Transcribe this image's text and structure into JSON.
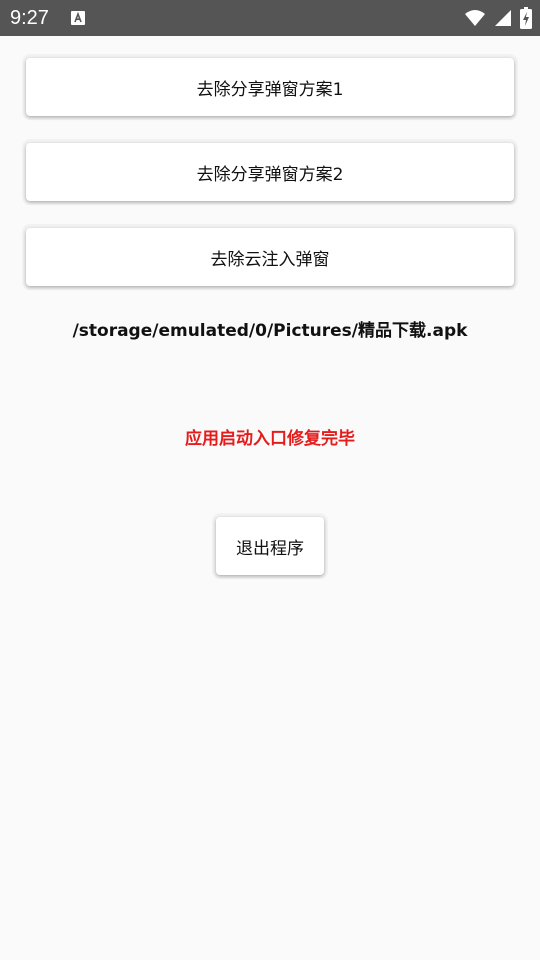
{
  "status_bar": {
    "time": "9:27",
    "notification_icon": "font-a-icon",
    "icons": [
      "wifi-icon",
      "signal-icon",
      "battery-charging-icon"
    ]
  },
  "buttons": {
    "remove_share_popup_1": "去除分享弹窗方案1",
    "remove_share_popup_2": "去除分享弹窗方案2",
    "remove_cloud_injection_popup": "去除云注入弹窗",
    "exit": "退出程序"
  },
  "file_path": "/storage/emulated/0/Pictures/精品下载.apk",
  "status_message": {
    "text": "应用启动入口修复完毕",
    "color": "#e51c1c"
  },
  "colors": {
    "status_bar": "#555555",
    "background": "#fafafa"
  }
}
